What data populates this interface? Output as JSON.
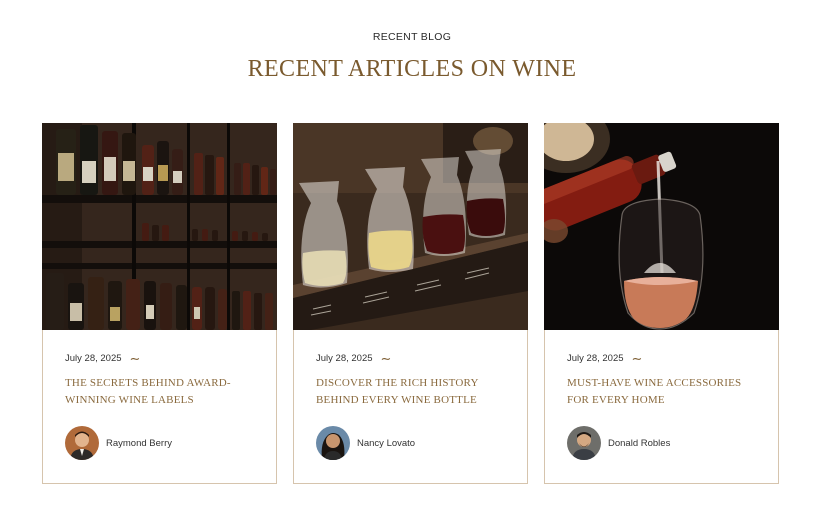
{
  "section": {
    "eyebrow": "RECENT BLOG",
    "heading": "RECENT ARTICLES ON WINE"
  },
  "accent_color": "#7a5a2e",
  "border_color": "#d6c4ad",
  "cards": [
    {
      "image": "wine-cellar-shelves",
      "date": "July 28, 2025",
      "title": "THE SECRETS BEHIND AWARD-WINNING WINE LABELS",
      "author": "Raymond Berry"
    },
    {
      "image": "wine-tasting-flight",
      "date": "July 28, 2025",
      "title": "DISCOVER THE RICH HISTORY BEHIND EVERY WINE BOTTLE",
      "author": "Nancy Lovato"
    },
    {
      "image": "rose-wine-pouring",
      "date": "July 28, 2025",
      "title": "MUST-HAVE WINE ACCESSORIES FOR EVERY HOME",
      "author": "Donald Robles"
    }
  ]
}
